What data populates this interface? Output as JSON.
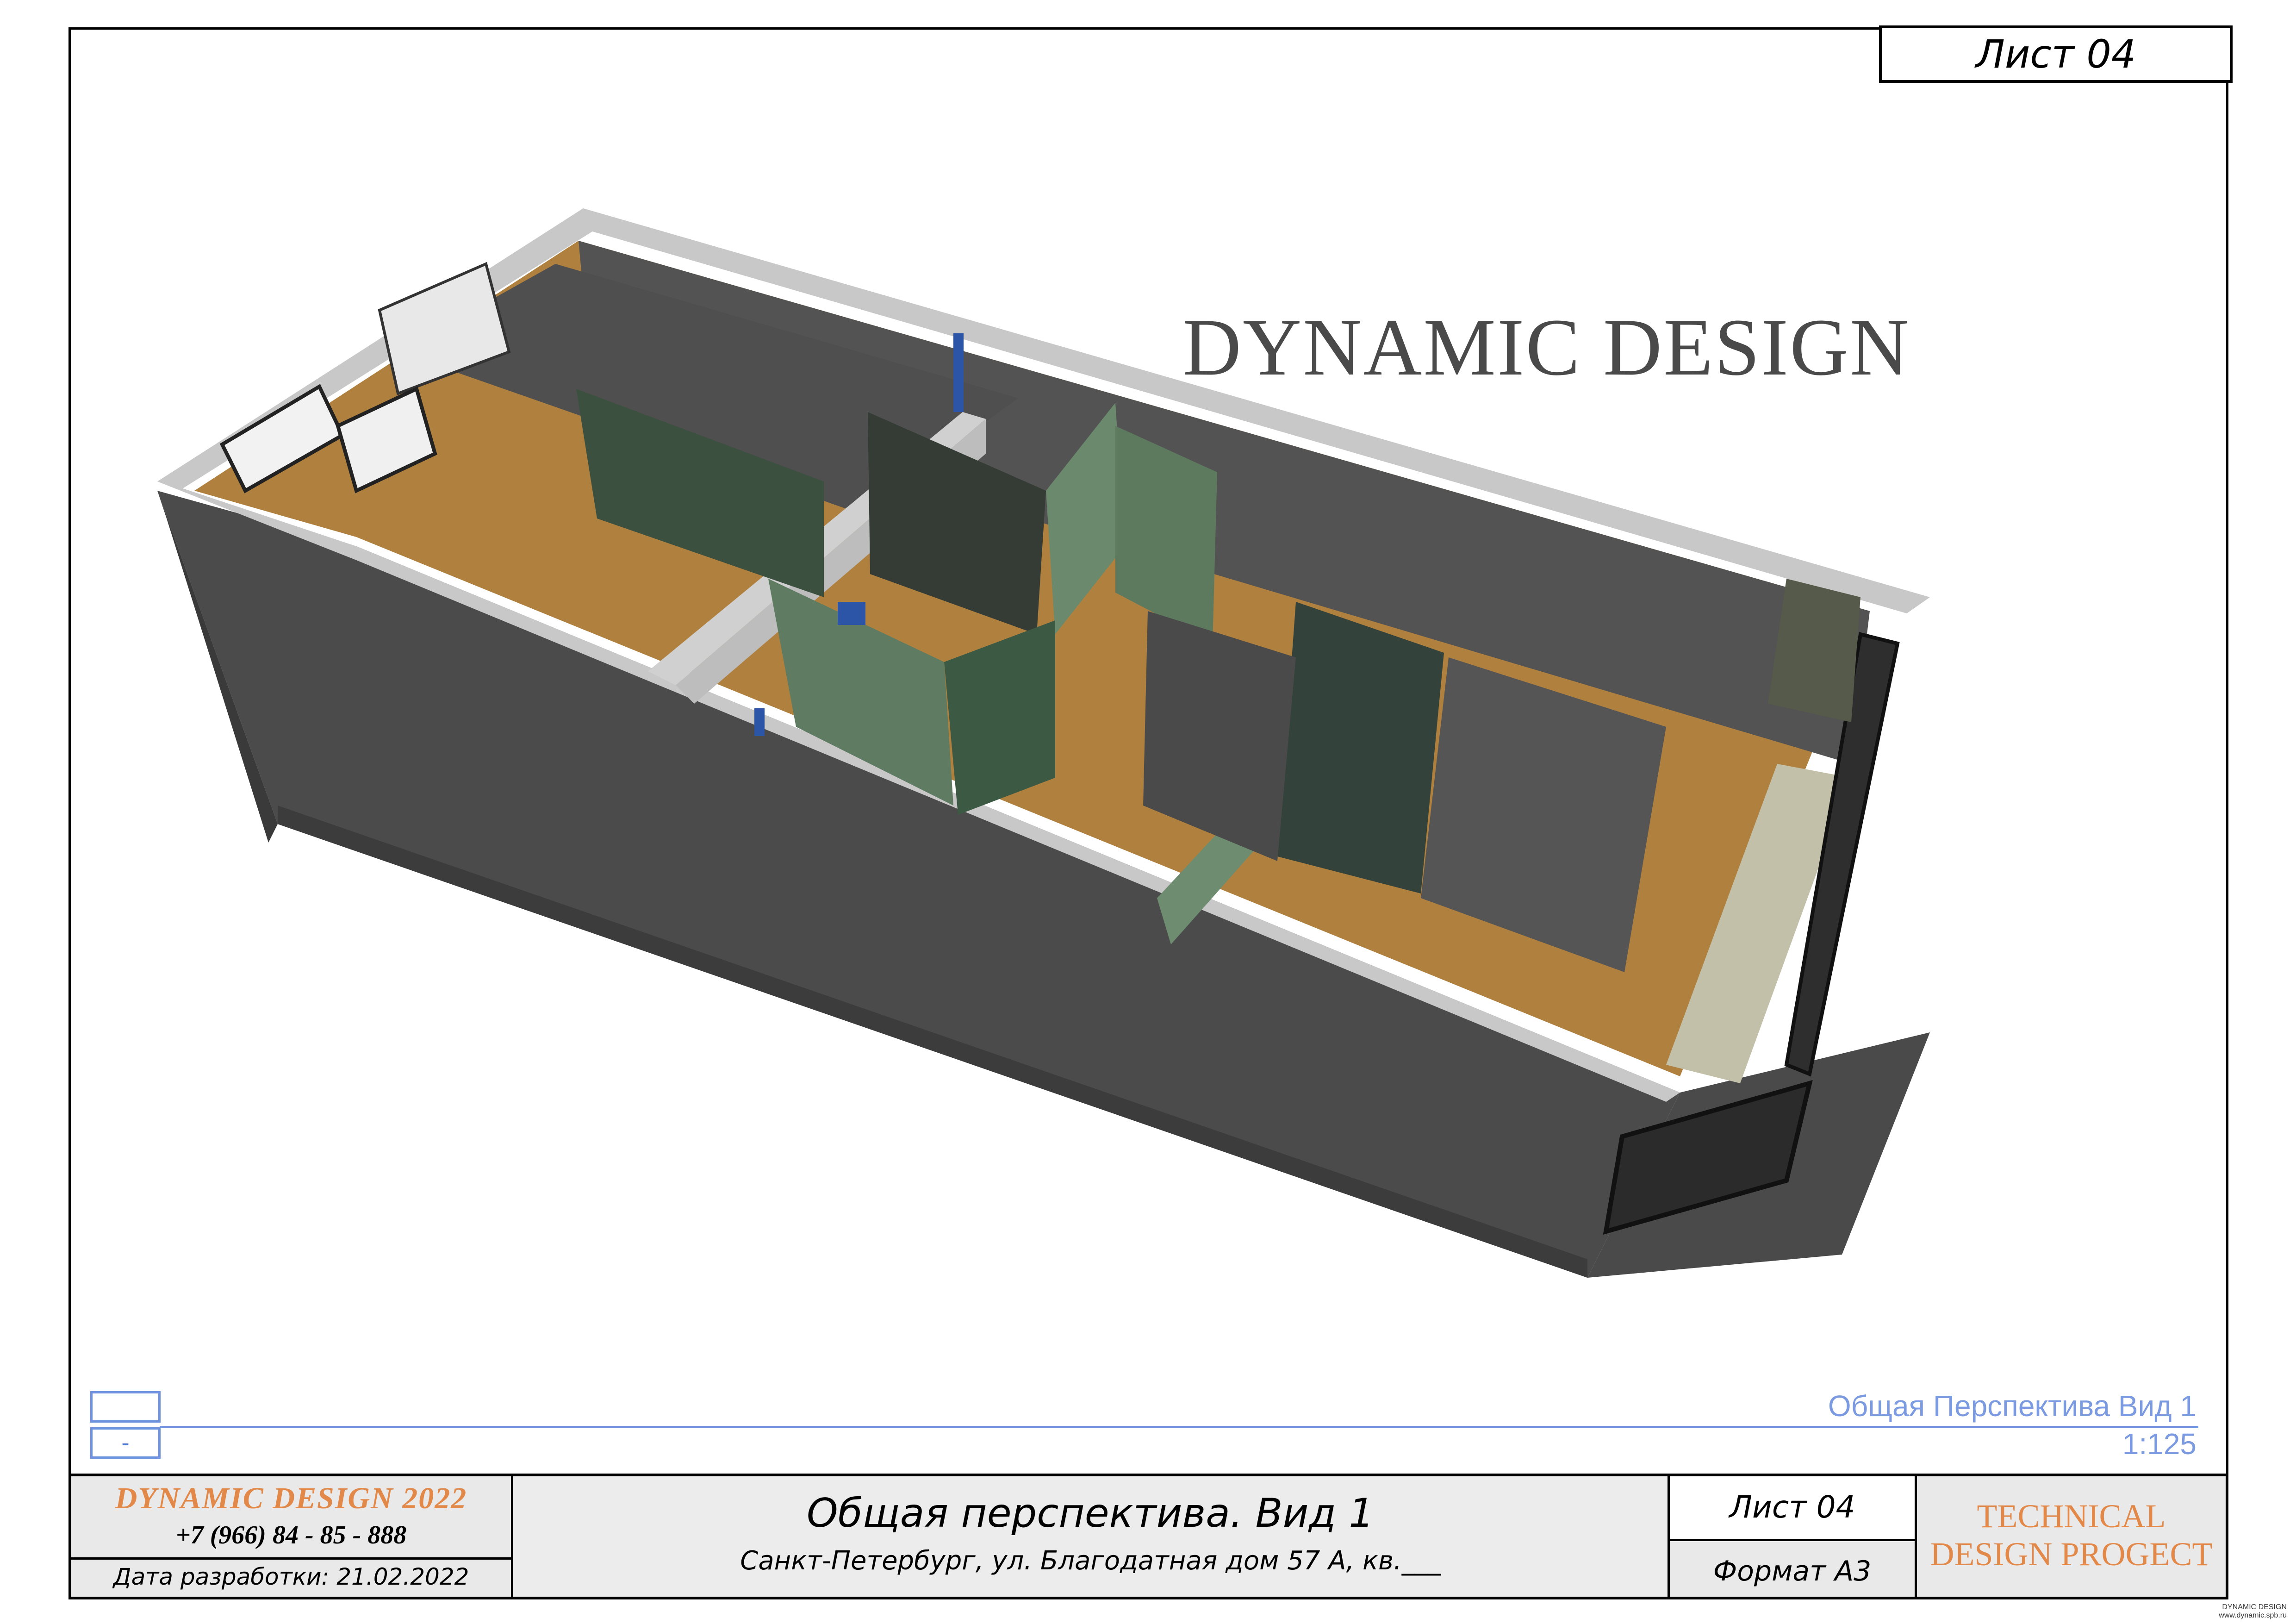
{
  "sheet_label_top": "Лист 04",
  "wordmark": "DYNAMIC DESIGN",
  "view": {
    "title": "Общая Перспектива Вид 1",
    "scale": "1:125",
    "box_upper": "",
    "box_lower": "-"
  },
  "title_block": {
    "brand": "DYNAMIC  DESIGN  2022",
    "phone": "+7  (966)  84 - 85 - 888",
    "date": "Дата разработки: 21.02.2022",
    "main_title": "Общая перспектива. Вид 1",
    "address": "Санкт-Петербург, ул. Благодатная дом 57 А, кв.___",
    "sheet": "Лист 04",
    "format": "Формат А3",
    "project_line1": "TECHNICAL",
    "project_line2": "DESIGN PROGECT"
  },
  "credit": {
    "line1": "DYNAMIC DESIGN",
    "line2": "www.dynamic.spb.ru"
  },
  "colors": {
    "accent": "#e2894a",
    "view_blue": "#7b9ae0",
    "wall_dark": "#4d4d4d",
    "floor": "#b07e3c",
    "partition_green": "#3e5343"
  }
}
